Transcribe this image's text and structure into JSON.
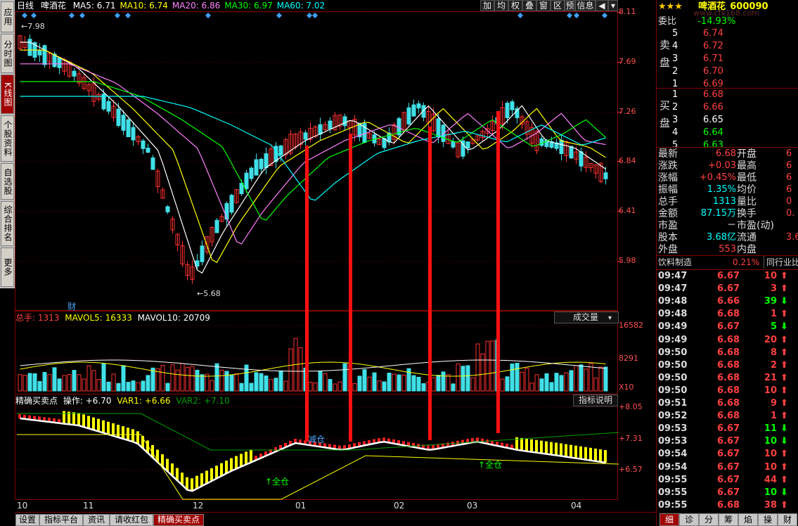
{
  "sidebar": {
    "items": [
      {
        "label": "应用",
        "active": false
      },
      {
        "label": "分时图",
        "active": false
      },
      {
        "label": "K线图",
        "active": true
      },
      {
        "label": "个股资料",
        "active": false
      },
      {
        "label": "自选股",
        "active": false
      },
      {
        "label": "综合排名",
        "active": false
      },
      {
        "label": "更多",
        "active": false
      }
    ]
  },
  "header": {
    "period": "日线",
    "stock_name": "啤酒花",
    "ma": [
      {
        "label": "MA5: 6.71",
        "color": "#ffffff"
      },
      {
        "label": "MA10: 6.74",
        "color": "#ffff00"
      },
      {
        "label": "MA20: 6.86",
        "color": "#ff80ff"
      },
      {
        "label": "MA30: 6.97",
        "color": "#00ff00"
      },
      {
        "label": "MA60: 7.02",
        "color": "#00ffff"
      }
    ]
  },
  "toolbar": [
    "加",
    "均",
    "权",
    "叠",
    "窗",
    "区",
    "预",
    "信息"
  ],
  "price_axis": [
    "8.11",
    "7.69",
    "7.26",
    "6.84",
    "6.41",
    "5.98"
  ],
  "annotations": {
    "high": "7.98",
    "low": "5.68",
    "fin": "财"
  },
  "volume": {
    "label_prefix": "总手:",
    "total": "1313",
    "mavol5": "MAVOL5: 16333",
    "mavol10": "MAVOL10: 20709",
    "selector": "成交量",
    "axis": [
      "16582",
      "8291"
    ],
    "multiplier": "X10"
  },
  "indicator": {
    "name": "精确买卖点",
    "op": "操作: +6.70",
    "var1": "VAR1: +6.66",
    "var2": "VAR2: +7.10",
    "help": "指标说明",
    "axis": [
      "+8.05",
      "+7.31",
      "+6.57"
    ],
    "labels": {
      "reduce": "减仓",
      "full1": "↑全仓",
      "full2": "↑全仓"
    }
  },
  "date_axis": [
    "10",
    "11",
    "12",
    "01",
    "02",
    "03",
    "04"
  ],
  "bottom_tabs": [
    {
      "label": "设置",
      "active": false
    },
    {
      "label": "指标平台",
      "active": false
    },
    {
      "label": "资讯",
      "active": false
    },
    {
      "label": "请收红包",
      "active": false
    },
    {
      "label": "精确买卖点",
      "active": true
    }
  ],
  "quote": {
    "stars": "★★★",
    "name": "啤酒花",
    "code": "600090",
    "watermark": "www.cfx168.com",
    "weibi_label": "委比",
    "weibi": "-14.93%",
    "sell_label": "卖盘",
    "buy_label": "买盘",
    "sell": [
      {
        "n": "5",
        "p": "6.74"
      },
      {
        "n": "4",
        "p": "6.72"
      },
      {
        "n": "3",
        "p": "6.71"
      },
      {
        "n": "2",
        "p": "6.70"
      },
      {
        "n": "1",
        "p": "6.69"
      }
    ],
    "buy": [
      {
        "n": "1",
        "p": "6.68",
        "c": "#ff4040"
      },
      {
        "n": "2",
        "p": "6.66",
        "c": "#ff4040"
      },
      {
        "n": "3",
        "p": "6.65",
        "c": "#ffffff"
      },
      {
        "n": "4",
        "p": "6.64",
        "c": "#00ff00"
      },
      {
        "n": "5",
        "p": "6.63",
        "c": "#00ff00"
      }
    ],
    "stats": [
      {
        "k": "最新",
        "v": "6.68",
        "vc": "#ff4040",
        "k2": "开盘",
        "v2": "6"
      },
      {
        "k": "涨跌",
        "v": "+0.03",
        "vc": "#ff4040",
        "k2": "最高",
        "v2": "6"
      },
      {
        "k": "涨幅",
        "v": "+0.45%",
        "vc": "#ff4040",
        "k2": "最低",
        "v2": "6"
      },
      {
        "k": "振幅",
        "v": "1.35%",
        "vc": "#00ffff",
        "k2": "均价",
        "v2": "6"
      },
      {
        "k": "总手",
        "v": "1313",
        "vc": "#00ffff",
        "k2": "量比",
        "v2": "0"
      },
      {
        "k": "金额",
        "v": "87.15万",
        "vc": "#00ffff",
        "k2": "换手",
        "v2": "0."
      },
      {
        "k": "市盈",
        "v": "－",
        "vc": "#ffffff",
        "k2": "市盈(动)",
        "v2": ""
      },
      {
        "k": "股本",
        "v": "3.68亿",
        "vc": "#00ffff",
        "k2": "流通",
        "v2": "3.6"
      },
      {
        "k": "外盘",
        "v": "553",
        "vc": "#ff4040",
        "k2": "内盘",
        "v2": ""
      }
    ],
    "industry": "饮料制造",
    "industry_pct": "0.21%",
    "industry_tab": "同行业比"
  },
  "ticks": [
    {
      "t": "09:47",
      "p": "6.67",
      "v": "10",
      "d": "up"
    },
    {
      "t": "09:47",
      "p": "6.67",
      "v": "3",
      "d": "up"
    },
    {
      "t": "09:48",
      "p": "6.66",
      "v": "39",
      "d": "down"
    },
    {
      "t": "09:48",
      "p": "6.68",
      "v": "1",
      "d": "up"
    },
    {
      "t": "09:49",
      "p": "6.67",
      "v": "5",
      "d": "down"
    },
    {
      "t": "09:49",
      "p": "6.68",
      "v": "20",
      "d": "up"
    },
    {
      "t": "09:50",
      "p": "6.68",
      "v": "8",
      "d": "up"
    },
    {
      "t": "09:50",
      "p": "6.68",
      "v": "2",
      "d": "up"
    },
    {
      "t": "09:50",
      "p": "6.68",
      "v": "21",
      "d": "up"
    },
    {
      "t": "09:50",
      "p": "6.68",
      "v": "10",
      "d": "up"
    },
    {
      "t": "09:51",
      "p": "6.68",
      "v": "9",
      "d": "up"
    },
    {
      "t": "09:52",
      "p": "6.68",
      "v": "1",
      "d": "up"
    },
    {
      "t": "09:53",
      "p": "6.67",
      "v": "11",
      "d": "down"
    },
    {
      "t": "09:53",
      "p": "6.67",
      "v": "10",
      "d": "down"
    },
    {
      "t": "09:54",
      "p": "6.67",
      "v": "10",
      "d": "up"
    },
    {
      "t": "09:54",
      "p": "6.67",
      "v": "10",
      "d": "up"
    },
    {
      "t": "09:55",
      "p": "6.67",
      "v": "44",
      "d": "up"
    },
    {
      "t": "09:55",
      "p": "6.67",
      "v": "10",
      "d": "down"
    },
    {
      "t": "09:55",
      "p": "6.68",
      "v": "38",
      "d": "up"
    }
  ],
  "right_tabs": [
    {
      "label": "细",
      "active": true
    },
    {
      "label": "诊",
      "active": false
    },
    {
      "label": "分",
      "active": false
    },
    {
      "label": "筹",
      "active": false
    },
    {
      "label": "焰",
      "active": false
    },
    {
      "label": "操",
      "active": false
    },
    {
      "label": "财",
      "active": false
    }
  ]
}
